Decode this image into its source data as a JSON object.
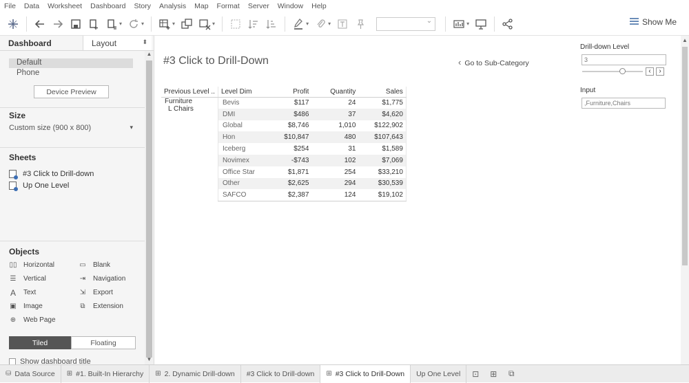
{
  "menu": [
    "File",
    "Data",
    "Worksheet",
    "Dashboard",
    "Story",
    "Analysis",
    "Map",
    "Format",
    "Server",
    "Window",
    "Help"
  ],
  "toolbar": {
    "show_me": "Show Me"
  },
  "left_pane": {
    "tab_dashboard": "Dashboard",
    "tab_layout": "Layout",
    "devices": [
      "Default",
      "Phone"
    ],
    "device_preview": "Device Preview",
    "size_title": "Size",
    "size_value": "Custom size (900 x 800)",
    "sheets_title": "Sheets",
    "sheets": [
      "#3 Click to Drill-down",
      "Up One Level"
    ],
    "objects_title": "Objects",
    "objects": [
      {
        "label": "Horizontal",
        "icon": "horizontal-icon"
      },
      {
        "label": "Blank",
        "icon": "blank-icon"
      },
      {
        "label": "Vertical",
        "icon": "vertical-icon"
      },
      {
        "label": "Navigation",
        "icon": "navigation-icon"
      },
      {
        "label": "Text",
        "icon": "text-icon"
      },
      {
        "label": "Export",
        "icon": "export-icon"
      },
      {
        "label": "Image",
        "icon": "image-icon"
      },
      {
        "label": "Extension",
        "icon": "extension-icon"
      },
      {
        "label": "Web Page",
        "icon": "web-page-icon"
      }
    ],
    "tiled": "Tiled",
    "floating": "Floating",
    "show_title": "Show dashboard title"
  },
  "canvas": {
    "title": "#3 Click to Drill-Down",
    "goto": "Go to Sub-Category",
    "table": {
      "headers": [
        "Previous Level ..",
        "Level Dim",
        "Profit",
        "Quantity",
        "Sales"
      ],
      "prev_category": "Furniture",
      "prev_subcategory": "L Chairs",
      "rows": [
        [
          "Bevis",
          "$117",
          "24",
          "$1,775"
        ],
        [
          "DMI",
          "$486",
          "37",
          "$4,620"
        ],
        [
          "Global",
          "$8,746",
          "1,010",
          "$122,902"
        ],
        [
          "Hon",
          "$10,847",
          "480",
          "$107,643"
        ],
        [
          "Iceberg",
          "$254",
          "31",
          "$1,589"
        ],
        [
          "Novimex",
          "-$743",
          "102",
          "$7,069"
        ],
        [
          "Office Star",
          "$1,871",
          "254",
          "$33,210"
        ],
        [
          "Other",
          "$2,625",
          "294",
          "$30,539"
        ],
        [
          "SAFCO",
          "$2,387",
          "124",
          "$19,102"
        ]
      ]
    },
    "drill_label": "Drill-down Level",
    "drill_value": "3",
    "input_label": "Input",
    "input_value": ",Furniture,Chairs"
  },
  "bottom_tabs": [
    {
      "label": "Data Source",
      "icon": "database-icon"
    },
    {
      "label": "#1. Built-In Hierarchy",
      "icon": "grid-icon"
    },
    {
      "label": "2. Dynamic Drill-down",
      "icon": "grid-icon"
    },
    {
      "label": "#3 Click to Drill-down",
      "icon": ""
    },
    {
      "label": "#3 Click to Drill-Down",
      "icon": "grid-icon",
      "active": true
    },
    {
      "label": "Up One Level",
      "icon": ""
    }
  ]
}
